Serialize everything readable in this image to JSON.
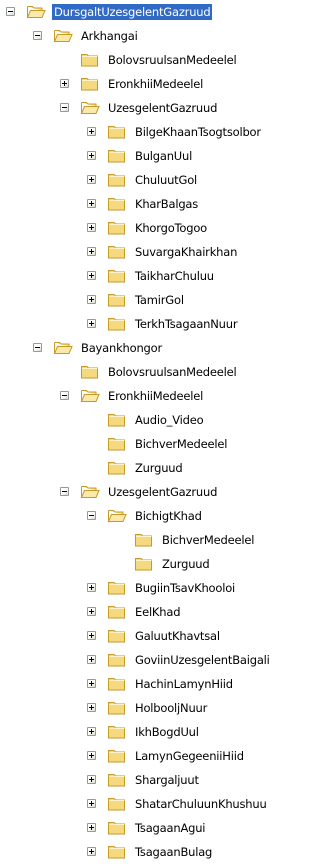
{
  "tree": {
    "colors": {
      "selection_background": "#316ac5",
      "selection_text": "#ffffff",
      "folder_fill": "#f5d97e",
      "folder_outline": "#c59a28",
      "expander_border": "#919b9c"
    },
    "icons": {
      "folder_closed": "folder-icon",
      "folder_open": "folder-open-icon",
      "expand": "plus-icon",
      "collapse": "minus-icon"
    },
    "nodes": [
      {
        "label": "DursgaltUzesgelentGazruud",
        "level": 0,
        "expander": "minus",
        "folder": "open",
        "selected": true
      },
      {
        "label": "Arkhangai",
        "level": 1,
        "expander": "minus",
        "folder": "open"
      },
      {
        "label": "BolovsruulsanMedeelel",
        "level": 2,
        "expander": "none",
        "folder": "closed"
      },
      {
        "label": "EronkhiiMedeelel",
        "level": 2,
        "expander": "plus",
        "folder": "closed"
      },
      {
        "label": "UzesgelentGazruud",
        "level": 2,
        "expander": "minus",
        "folder": "open"
      },
      {
        "label": "BilgeKhaanTsogtsolbor",
        "level": 3,
        "expander": "plus",
        "folder": "closed"
      },
      {
        "label": "BulganUul",
        "level": 3,
        "expander": "plus",
        "folder": "closed"
      },
      {
        "label": "ChuluutGol",
        "level": 3,
        "expander": "plus",
        "folder": "closed"
      },
      {
        "label": "KharBalgas",
        "level": 3,
        "expander": "plus",
        "folder": "closed"
      },
      {
        "label": "KhorgoTogoo",
        "level": 3,
        "expander": "plus",
        "folder": "closed"
      },
      {
        "label": "SuvargaKhairkhan",
        "level": 3,
        "expander": "plus",
        "folder": "closed"
      },
      {
        "label": "TaikharChuluu",
        "level": 3,
        "expander": "plus",
        "folder": "closed"
      },
      {
        "label": "TamirGol",
        "level": 3,
        "expander": "plus",
        "folder": "closed"
      },
      {
        "label": "TerkhTsagaanNuur",
        "level": 3,
        "expander": "plus",
        "folder": "closed"
      },
      {
        "label": "Bayankhongor",
        "level": 1,
        "expander": "minus",
        "folder": "open"
      },
      {
        "label": "BolovsruulsanMedeelel",
        "level": 2,
        "expander": "none",
        "folder": "closed"
      },
      {
        "label": "EronkhiiMedeelel",
        "level": 2,
        "expander": "minus",
        "folder": "open"
      },
      {
        "label": "Audio_Video",
        "level": 3,
        "expander": "none",
        "folder": "closed"
      },
      {
        "label": "BichverMedeelel",
        "level": 3,
        "expander": "none",
        "folder": "closed"
      },
      {
        "label": "Zurguud",
        "level": 3,
        "expander": "none",
        "folder": "closed"
      },
      {
        "label": "UzesgelentGazruud",
        "level": 2,
        "expander": "minus",
        "folder": "open"
      },
      {
        "label": "BichigtKhad",
        "level": 3,
        "expander": "minus",
        "folder": "open"
      },
      {
        "label": "BichverMedeelel",
        "level": 4,
        "expander": "none",
        "folder": "closed"
      },
      {
        "label": "Zurguud",
        "level": 4,
        "expander": "none",
        "folder": "closed"
      },
      {
        "label": "BugiinTsavKhooloi",
        "level": 3,
        "expander": "plus",
        "folder": "closed"
      },
      {
        "label": "EelKhad",
        "level": 3,
        "expander": "plus",
        "folder": "closed"
      },
      {
        "label": "GaluutKhavtsal",
        "level": 3,
        "expander": "plus",
        "folder": "closed"
      },
      {
        "label": "GoviinUzesgelentBaigali",
        "level": 3,
        "expander": "plus",
        "folder": "closed"
      },
      {
        "label": "HachinLamynHiid",
        "level": 3,
        "expander": "plus",
        "folder": "closed"
      },
      {
        "label": "HolbooljNuur",
        "level": 3,
        "expander": "plus",
        "folder": "closed"
      },
      {
        "label": "IkhBogdUul",
        "level": 3,
        "expander": "plus",
        "folder": "closed"
      },
      {
        "label": "LamynGegeeniiHiid",
        "level": 3,
        "expander": "plus",
        "folder": "closed"
      },
      {
        "label": "Shargaljuut",
        "level": 3,
        "expander": "plus",
        "folder": "closed"
      },
      {
        "label": "ShatarChuluunKhushuu",
        "level": 3,
        "expander": "plus",
        "folder": "closed"
      },
      {
        "label": "TsagaanAgui",
        "level": 3,
        "expander": "plus",
        "folder": "closed"
      },
      {
        "label": "TsagaanBulag",
        "level": 3,
        "expander": "plus",
        "folder": "closed"
      }
    ]
  }
}
